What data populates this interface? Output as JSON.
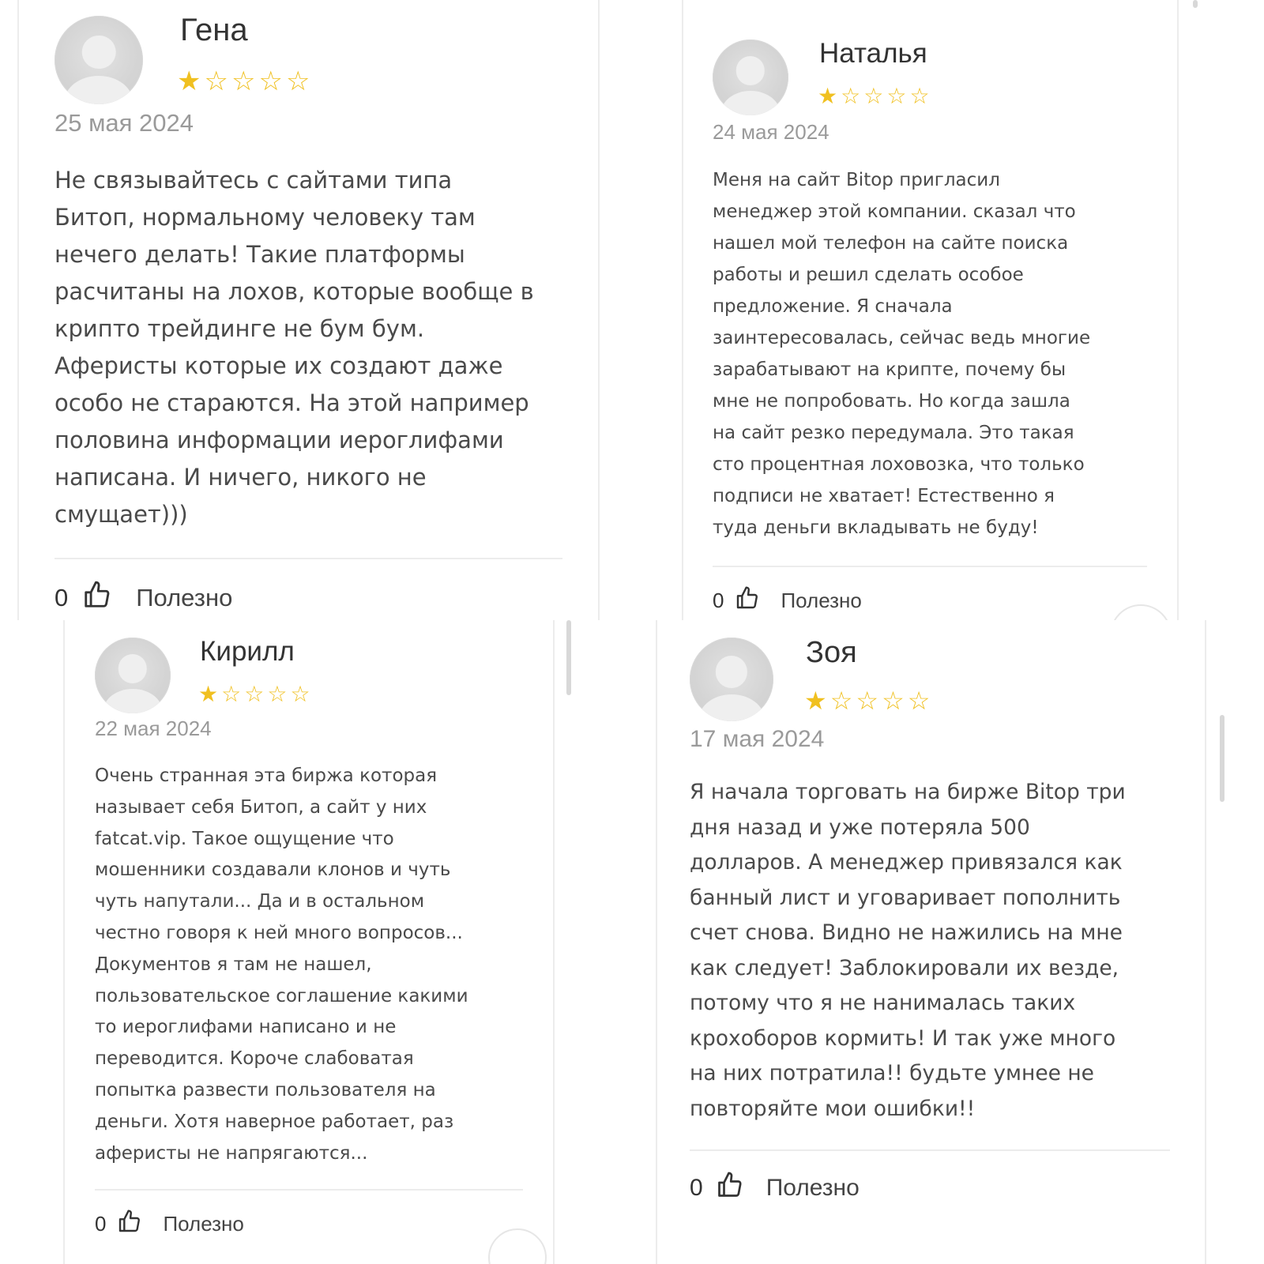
{
  "reviews": [
    {
      "author": "Гена",
      "rating": 1,
      "rating_max": 5,
      "date": "25 мая 2024",
      "text": "Не связывайтесь с сайтами типа\nБитоп, нормальному человеку там\nнечего делать! Такие платформы\nрасчитаны на лохов, которые вообще в\nкрипто трейдинге не бум бум.\nАферисты которые их создают даже\nособо не стараются. На этой например\nполовина информации иероглифами\nнаписана. И ничего, никого не\nсмущает)))",
      "likes": "0",
      "useful_label": "Полезно"
    },
    {
      "author": "Наталья",
      "rating": 1,
      "rating_max": 5,
      "date": "24 мая 2024",
      "text": "Меня на сайт Bitop пригласил\nменеджер этой компании. сказал что\nнашел мой телефон на сайте поиска\nработы и решил сделать особое\nпредложение. Я сначала\nзаинтересовалась, сейчас ведь многие\nзарабатывают на крипте, почему бы\nмне не попробовать. Но когда зашла\nна сайт резко передумала. Это такая\nсто процентная лоховозка, что только\nподписи не хватает! Естественно я\nтуда деньги вкладывать не буду!",
      "likes": "0",
      "useful_label": "Полезно"
    },
    {
      "author": "Кирилл",
      "rating": 1,
      "rating_max": 5,
      "date": "22 мая 2024",
      "text": "Очень странная эта биржа которая\nназывает себя Битоп, а сайт у них\nfatcat.vip. Такое ощущение что\nмошенники создавали клонов и чуть\nчуть напутали... Да и в остальном\nчестно говоря к ней много вопросов...\nДокументов я там не нашел,\nпользовательское соглашение какими\nто иероглифами написано и не\nпереводится. Короче слабоватая\nпопытка развести пользователя на\nденьги. Хотя наверное работает, раз\nаферисты не напрягаются...",
      "likes": "0",
      "useful_label": "Полезно"
    },
    {
      "author": "Зоя",
      "rating": 1,
      "rating_max": 5,
      "date": "17 мая 2024",
      "text": "Я начала торговать на бирже Bitop три\nдня назад и уже потеряла 500\nдолларов. А менеджер привязался как\nбанный лист и уговаривает пополнить\nсчет снова. Видно не нажились на мне\nкак следует! Заблокировали их везде,\nпотому что я не нанималась таких\nкрохоборов кормить! И так уже много\nна них потратила!! будьте умнее не\nповторяйте мои ошибки!!",
      "likes": "0",
      "useful_label": "Полезно"
    }
  ],
  "icons": {
    "star_full": "star-filled-icon",
    "star_empty": "star-outline-icon",
    "like": "thumbs-up-icon",
    "avatar": "default-user-avatar"
  },
  "colors": {
    "star": "#f0c020",
    "text": "#4a4a4a",
    "date": "#9a9a9a",
    "divider": "#ececec"
  }
}
